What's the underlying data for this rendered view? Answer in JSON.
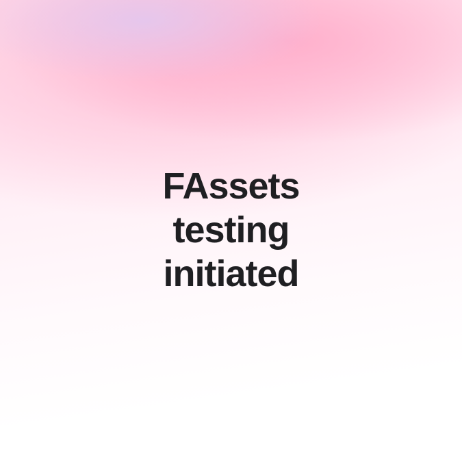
{
  "headline": {
    "line1": "FAssets",
    "line2": "testing",
    "line3": "initiated"
  }
}
